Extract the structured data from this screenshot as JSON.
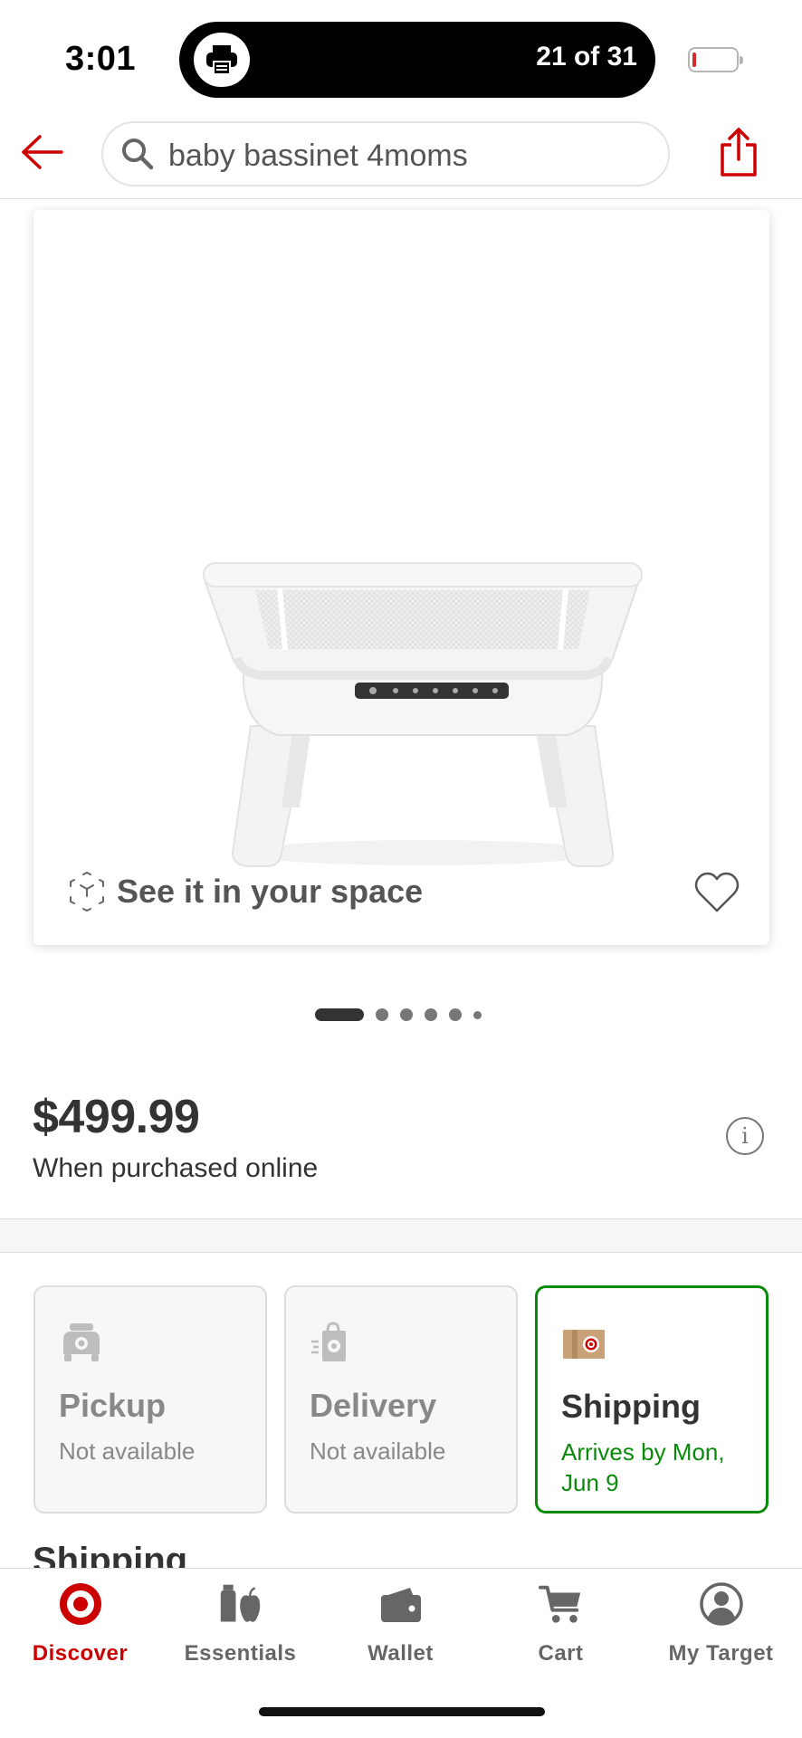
{
  "status_bar": {
    "time": "3:01",
    "print_counter": "21 of 31",
    "icons": [
      "printer-icon",
      "battery-icon"
    ]
  },
  "header": {
    "search_query": "baby bassinet 4moms",
    "icons": [
      "back-arrow-icon",
      "search-icon",
      "share-icon"
    ]
  },
  "product": {
    "ar_label": "See it in your space",
    "image_count": 6,
    "active_image_index": 0
  },
  "price": {
    "amount": "$499.99",
    "note": "When purchased online"
  },
  "fulfillment": [
    {
      "title": "Pickup",
      "status": "Not available",
      "icon": "pickup-car-icon",
      "selected": false
    },
    {
      "title": "Delivery",
      "status": "Not available",
      "icon": "delivery-bag-icon",
      "selected": false
    },
    {
      "title": "Shipping",
      "status": "Arrives by Mon, Jun 9",
      "icon": "shipping-box-icon",
      "selected": true
    }
  ],
  "section_heading": "Shipping",
  "tab_bar": [
    {
      "label": "Discover",
      "icon": "target-logo-icon",
      "active": true
    },
    {
      "label": "Essentials",
      "icon": "essentials-icon",
      "active": false
    },
    {
      "label": "Wallet",
      "icon": "wallet-icon",
      "active": false
    },
    {
      "label": "Cart",
      "icon": "cart-icon",
      "active": false
    },
    {
      "label": "My Target",
      "icon": "account-icon",
      "active": false
    }
  ],
  "colors": {
    "brand_red": "#cc0000",
    "shipping_green": "#0a8a0a",
    "text_dark": "#333333",
    "text_muted": "#888888"
  }
}
